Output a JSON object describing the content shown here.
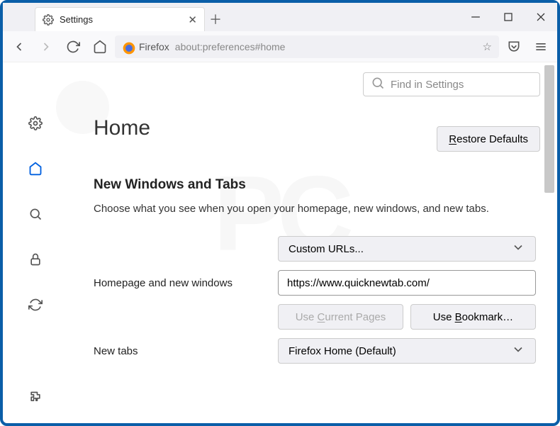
{
  "tab": {
    "title": "Settings"
  },
  "urlbar": {
    "brand": "Firefox",
    "url": "about:preferences#home"
  },
  "search": {
    "placeholder": "Find in Settings"
  },
  "page": {
    "title": "Home",
    "restore": "Restore Defaults",
    "section": "New Windows and Tabs",
    "desc": "Choose what you see when you open your homepage, new windows, and new tabs."
  },
  "fields": {
    "homepage_label": "Homepage and new windows",
    "homepage_select": "Custom URLs...",
    "homepage_url": "https://www.quicknewtab.com/",
    "use_current": "Use Current Pages",
    "use_bookmark": "Use Bookmark…",
    "newtabs_label": "New tabs",
    "newtabs_select": "Firefox Home (Default)"
  }
}
